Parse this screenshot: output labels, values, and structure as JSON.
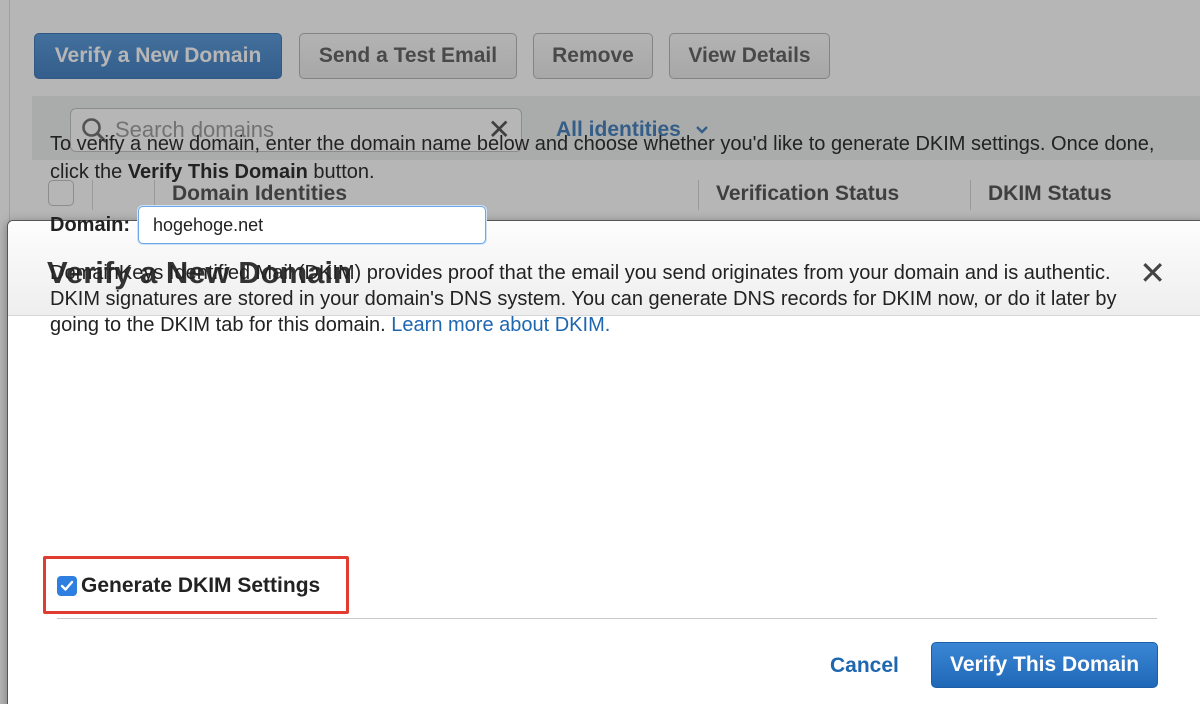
{
  "toolbar": {
    "verify_new_domain": "Verify a New Domain",
    "send_test_email": "Send a Test Email",
    "remove": "Remove",
    "view_details": "View Details"
  },
  "filter": {
    "search_placeholder": "Search domains",
    "identities_filter": "All identities"
  },
  "table": {
    "columns": [
      "Domain Identities",
      "Verification Status",
      "DKIM Status"
    ]
  },
  "modal": {
    "title": "Verify a New Domain",
    "intro_text": "To verify a new domain, enter the domain name below and choose whether you'd like to generate DKIM settings. Once done, click the ",
    "intro_bold": "Verify This Domain",
    "intro_end": " button.",
    "domain_label": "Domain:",
    "domain_value": "hogehoge.net",
    "dkim_description": "DomainKeys Identified Mail (DKIM) provides proof that the email you send originates from your domain and is authentic. DKIM signatures are stored in your domain's DNS system. You can generate DNS records for DKIM now, or do it later by going to the DKIM tab for this domain. ",
    "learn_more": "Learn more about DKIM.",
    "generate_dkim_label": "Generate DKIM Settings",
    "generate_dkim_checked": true,
    "cancel": "Cancel",
    "verify_button": "Verify This Domain"
  },
  "colors": {
    "primary_blue": "#1f66b0",
    "highlight_red": "#e03c2f"
  }
}
